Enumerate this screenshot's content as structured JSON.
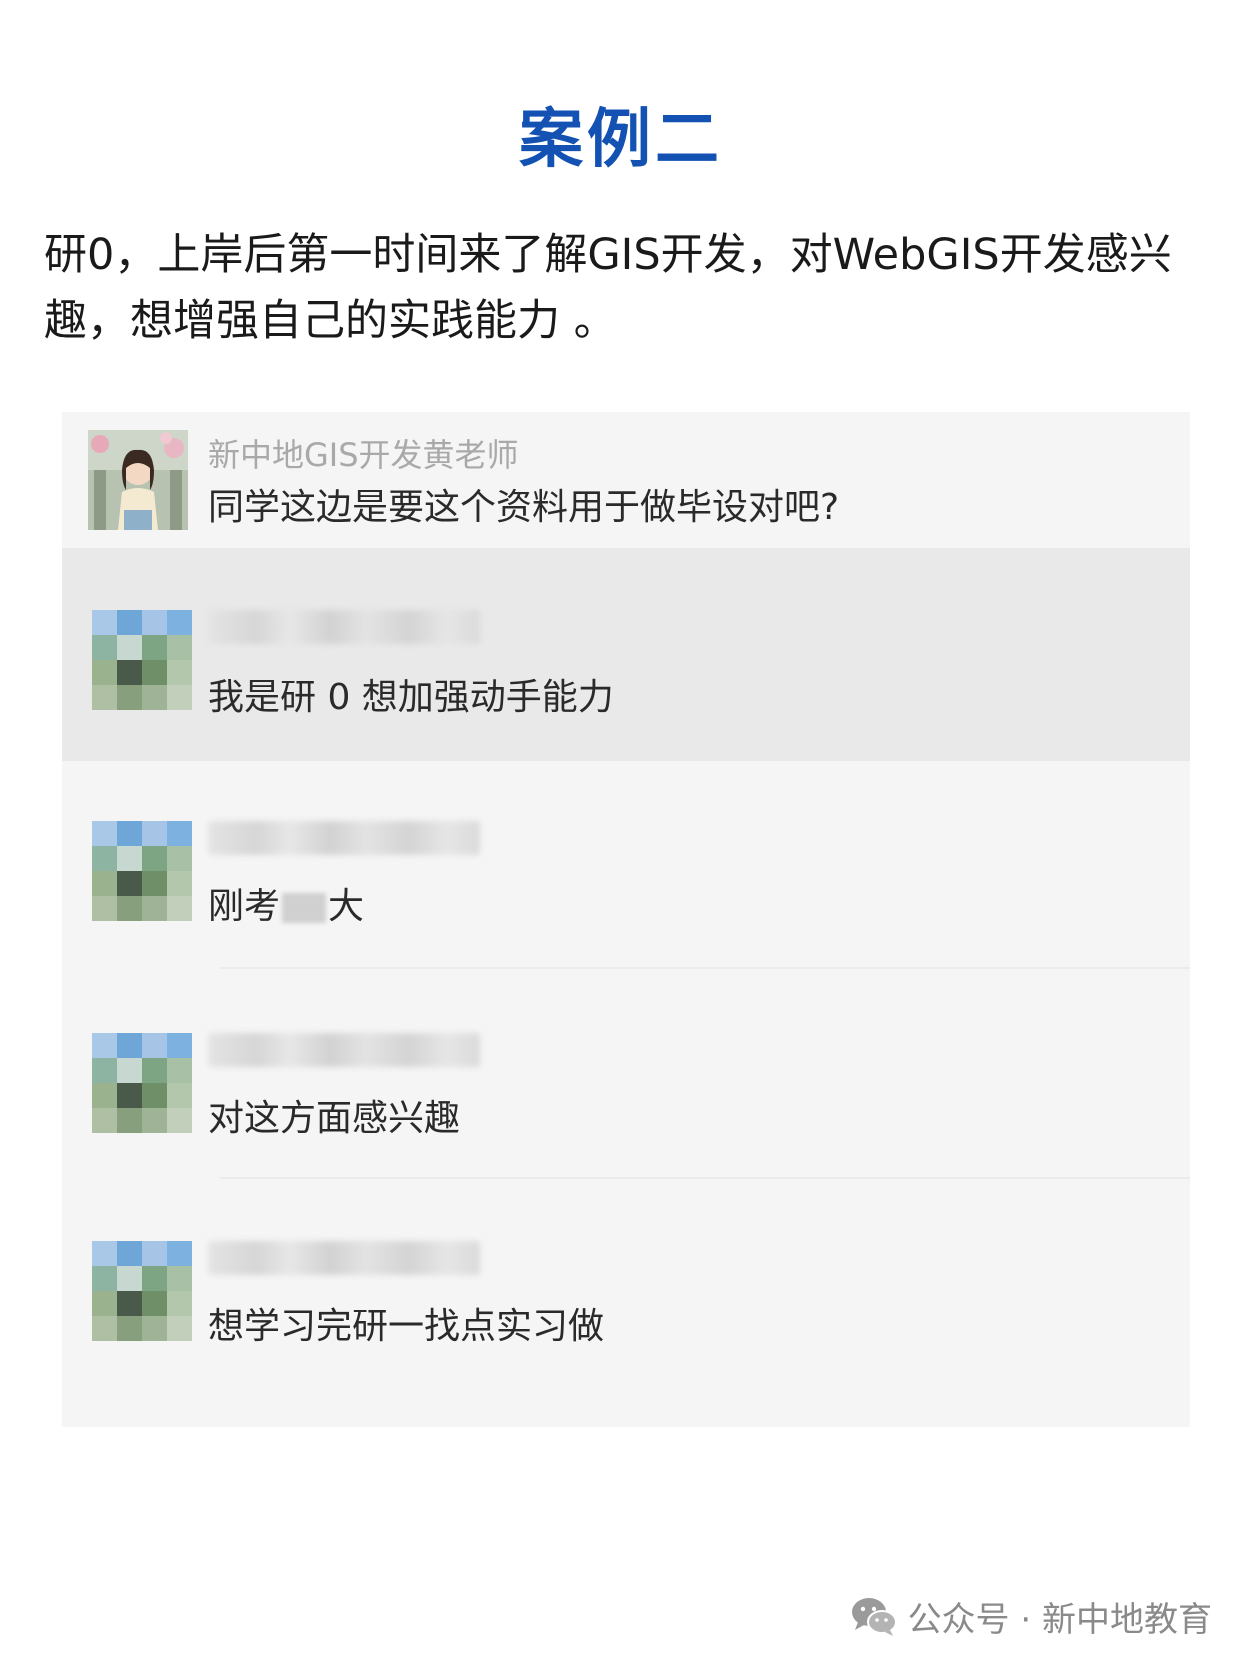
{
  "title": "案例二",
  "intro": "研0，上岸后第一时间来了解GIS开发，对WebGIS开发感兴趣，想增强自己的实践能力 。",
  "chat": {
    "messages": [
      {
        "sender": "新中地GIS开发黄老师",
        "text": "同学这边是要这个资料用于做毕设对吧?"
      },
      {
        "sender": "",
        "text": "我是研 0 想加强动手能力"
      },
      {
        "sender": "",
        "text_before": "刚考",
        "text_after": "大"
      },
      {
        "sender": "",
        "text": "对这方面感兴趣"
      },
      {
        "sender": "",
        "text": "想学习完研一找点实习做"
      }
    ]
  },
  "footer": {
    "label": "公众号 · 新中地教育",
    "icon": "wechat-icon"
  },
  "colors": {
    "title": "#1352b3",
    "chat_bg": "#f5f5f5",
    "highlight_row": "#e9e9e9"
  }
}
